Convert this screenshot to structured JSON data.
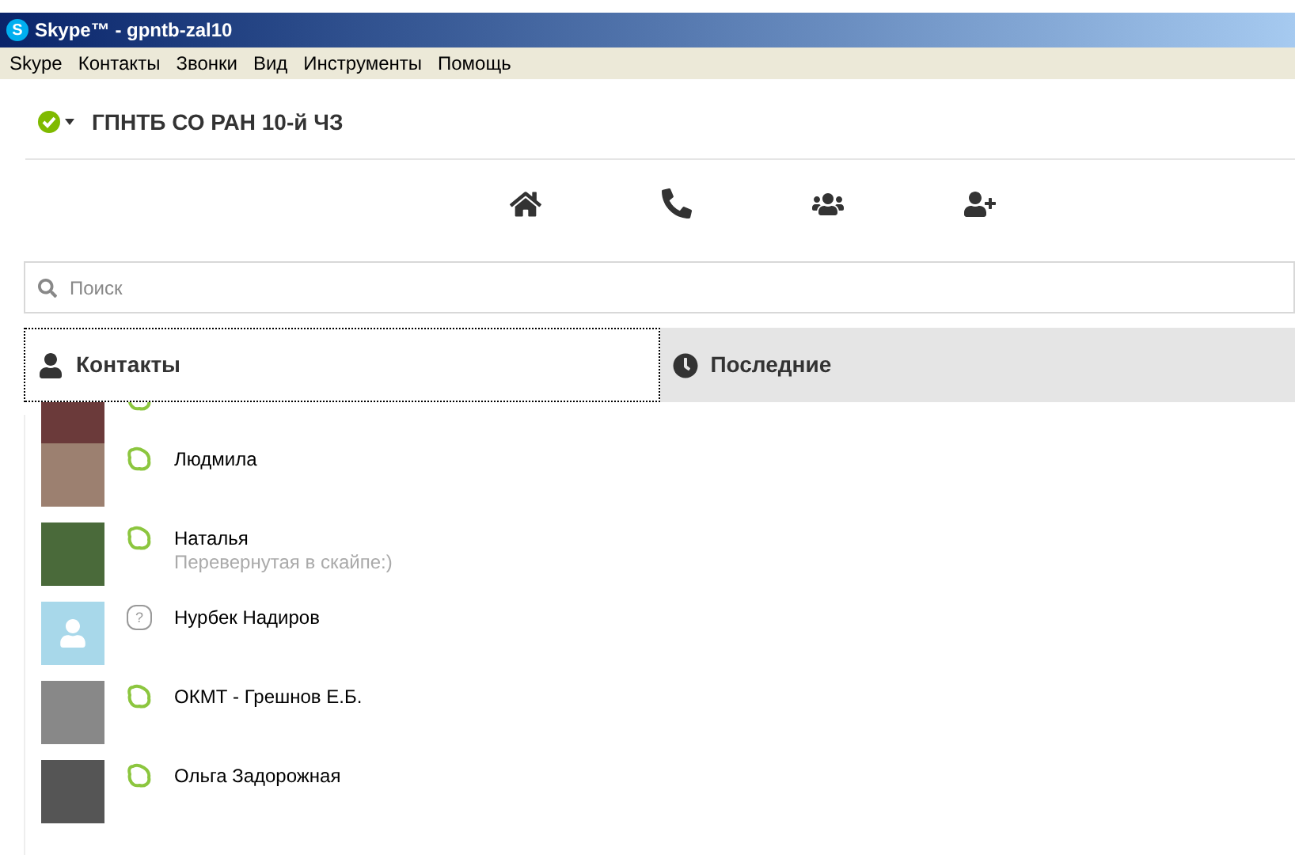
{
  "window": {
    "logo": "S",
    "title": "Skype™ - gpntb-zal10"
  },
  "menu": [
    "Skype",
    "Контакты",
    "Звонки",
    "Вид",
    "Инструменты",
    "Помощь"
  ],
  "account": {
    "name": "ГПНТБ СО РАН 10-й ЧЗ"
  },
  "search": {
    "placeholder": "Поиск"
  },
  "tabs": [
    {
      "label": "Контакты",
      "selected": true,
      "kind": "person"
    },
    {
      "label": "Последние",
      "selected": false,
      "kind": "clock"
    }
  ],
  "contacts": [
    {
      "kind": "photo",
      "online": true,
      "cut": true
    },
    {
      "kind": "photo",
      "online": true,
      "name": "Людмила",
      "cut": false
    },
    {
      "kind": "photo",
      "online": true,
      "name": "Наталья",
      "mood": "Перевернутая в скайпе:)",
      "cut": false
    },
    {
      "kind": "default",
      "online": false,
      "status_glyph": "?",
      "name": "Нурбек Надиров",
      "cut": false
    },
    {
      "kind": "photo",
      "online": true,
      "name": "ОКМТ - Грешнов Е.Б.",
      "cut": false
    },
    {
      "kind": "photo",
      "online": true,
      "name": "Ольга Задорожная",
      "cut": false
    }
  ]
}
